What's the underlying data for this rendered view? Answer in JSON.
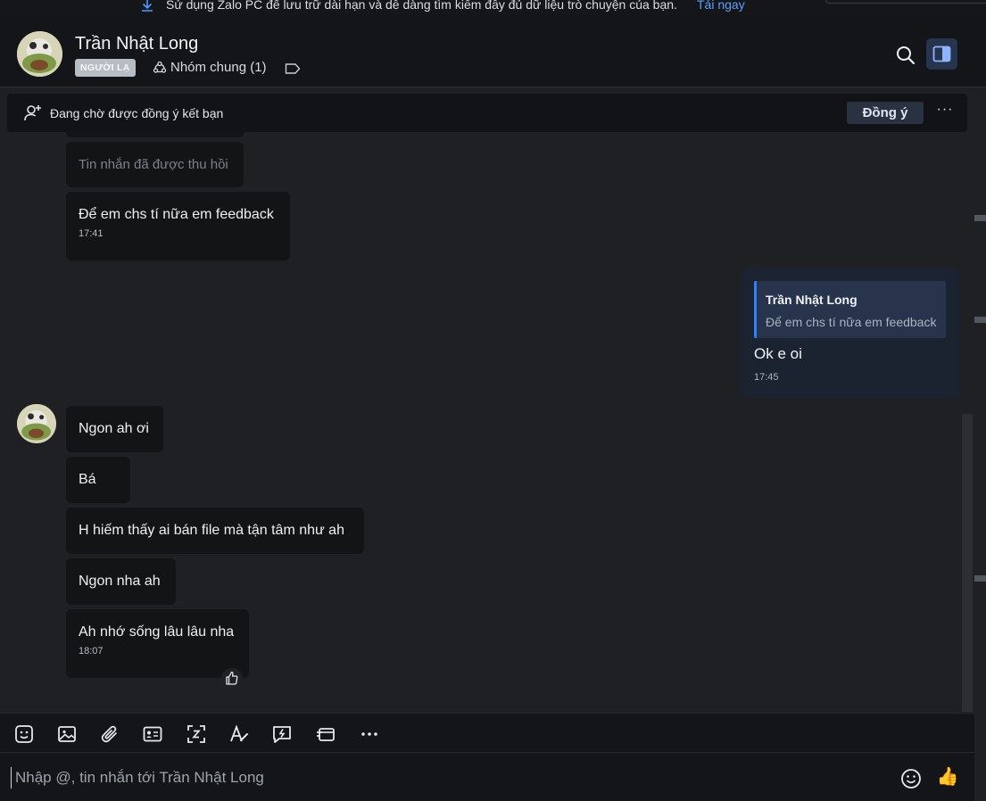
{
  "banner": {
    "text": "Sử dụng Zalo PC để lưu trữ dài hạn và dễ dàng tìm kiếm đầy đủ dữ liệu trò chuyện của bạn.",
    "link": "Tải ngay"
  },
  "header": {
    "contact_name": "Trần Nhật Long",
    "badge": "NGƯỜI LẠ",
    "common_groups": "Nhóm chung (1)"
  },
  "friend_request": {
    "status_text": "Đang chờ được đồng ý kết bạn",
    "accept_label": "Đồng ý",
    "more_label": "···"
  },
  "messages": {
    "recalled": "Tin nhắn đã được thu hồi",
    "m1": {
      "text": "Để em chs tí nữa em feedback",
      "time": "17:41"
    },
    "mine": {
      "quote_author": "Trần Nhật Long",
      "quote_text": "Để em chs tí nữa em feedback",
      "text": "Ok e oi",
      "time": "17:45"
    },
    "m2": {
      "text": "Ngon ah ơi"
    },
    "m3": {
      "text": "Bá"
    },
    "m4": {
      "text": "H hiếm thấy ai bán file mà tận tâm như ah"
    },
    "m5": {
      "text": "Ngon nha ah"
    },
    "m6": {
      "text": "Ah nhớ sống lâu lâu nha",
      "time": "18:07"
    }
  },
  "composer": {
    "placeholder": "Nhập @, tin nhắn tới Trần Nhật Long",
    "quick_reaction": "👍"
  },
  "colors": {
    "accent": "#2f80ff",
    "link": "#5aa0ff",
    "bubble_received": "#131416",
    "bubble_sent": "#1b2230"
  }
}
